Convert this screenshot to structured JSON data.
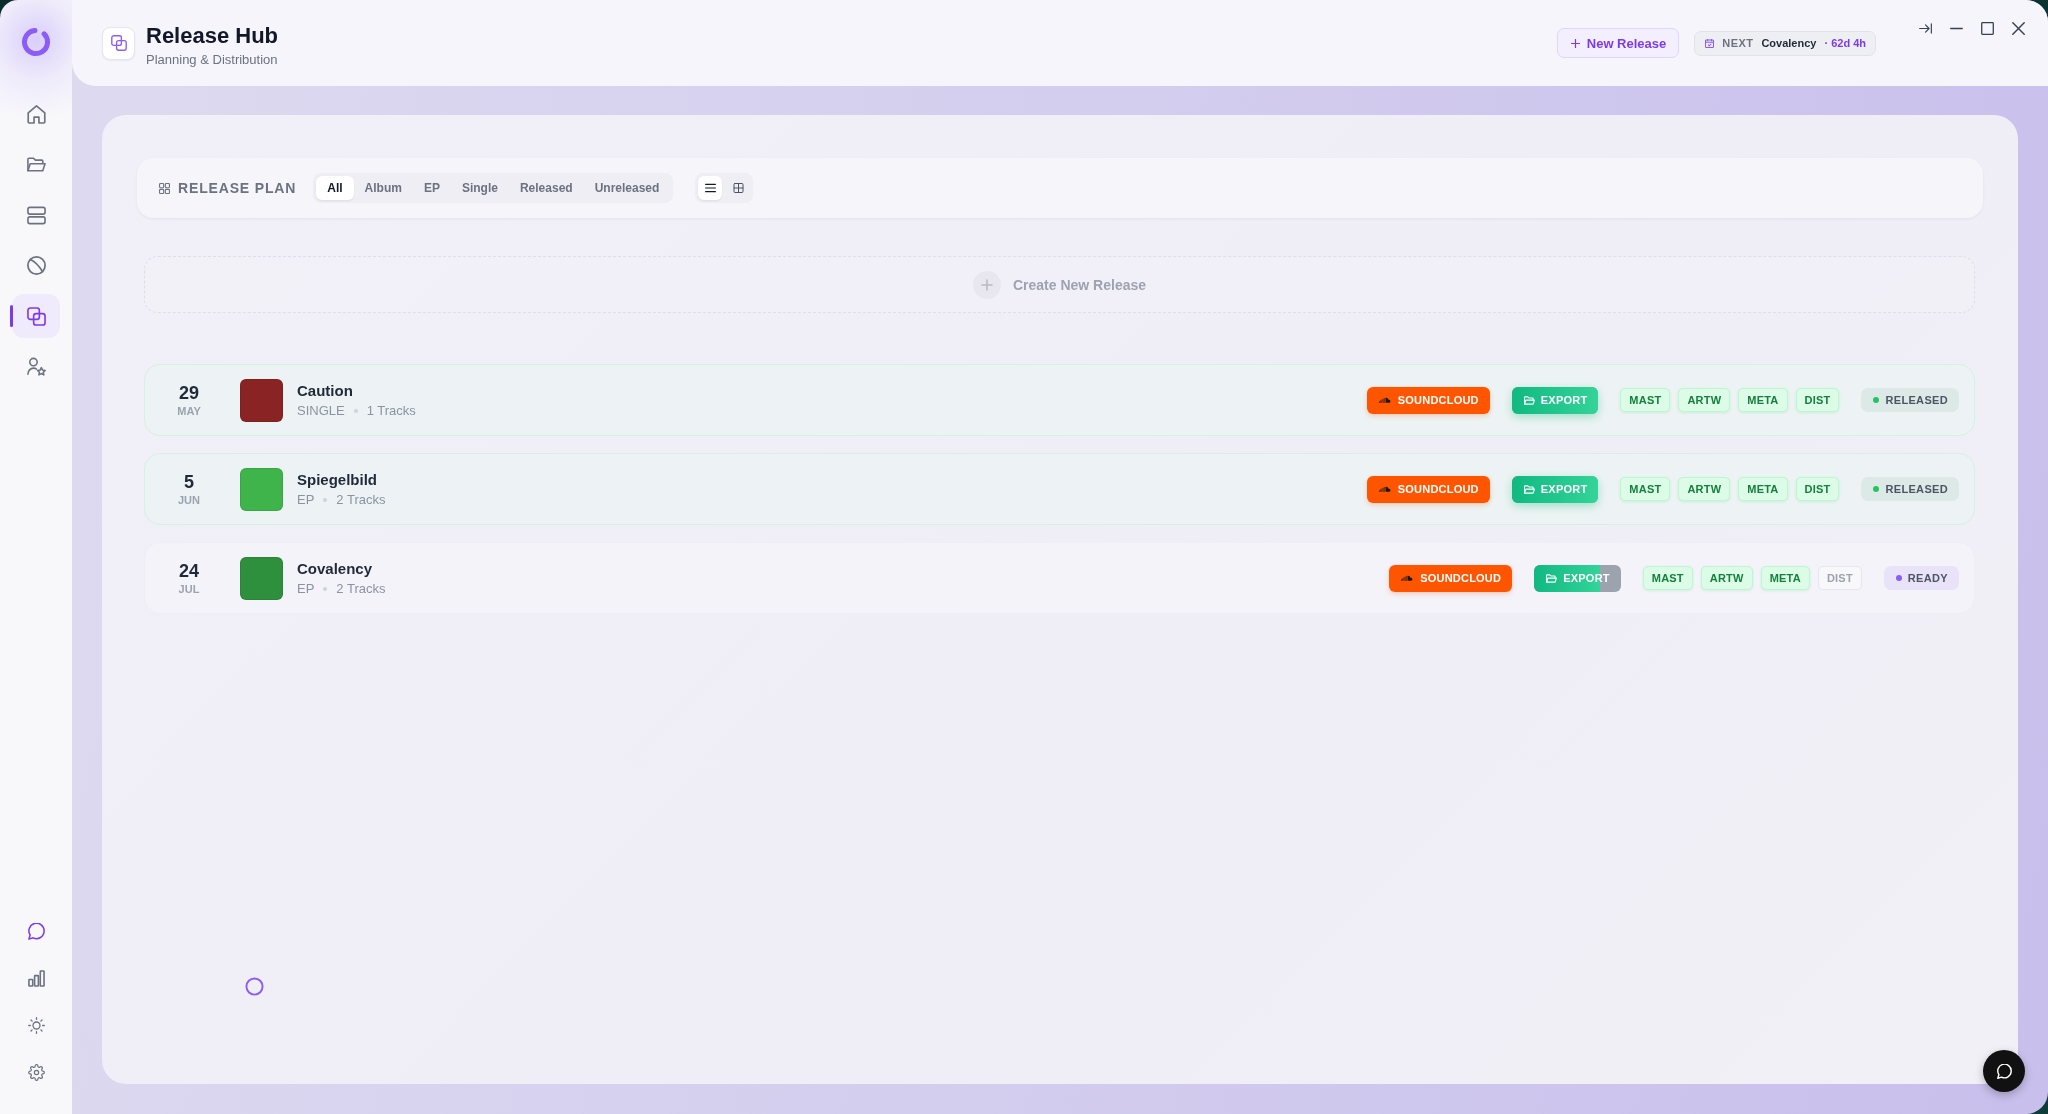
{
  "sidebar": {
    "nav_items": [
      {
        "selected": false
      },
      {
        "selected": false
      },
      {
        "selected": false
      },
      {
        "selected": false
      },
      {
        "selected": true
      },
      {
        "selected": false
      }
    ],
    "bottom_items": [
      {
        "active": true
      },
      {
        "active": false
      },
      {
        "active": false
      },
      {
        "active": false
      }
    ]
  },
  "header": {
    "title": "Release Hub",
    "subtitle": "Planning & Distribution",
    "new_release_button": "New Release",
    "next_chip": {
      "label": "NEXT",
      "release": "Covalency",
      "countdown": "· 62d 4h"
    }
  },
  "release_plan": {
    "title": "RELEASE PLAN",
    "filters": [
      {
        "label": "All",
        "selected": true
      },
      {
        "label": "Album",
        "selected": false
      },
      {
        "label": "EP",
        "selected": false
      },
      {
        "label": "Single",
        "selected": false
      },
      {
        "label": "Released",
        "selected": false
      },
      {
        "label": "Unreleased",
        "selected": false
      }
    ],
    "views": [
      {
        "selected": true
      },
      {
        "selected": false
      }
    ],
    "create_button": "Create New Release",
    "releases": [
      {
        "day": "29",
        "month": "MAY",
        "title": "Caution",
        "type": "SINGLE",
        "tracks": "1 Tracks",
        "cover": {
          "color": "#8a2424"
        },
        "platform_button": "SOUNDCLOUD",
        "export": {
          "label": "EXPORT",
          "level": 1
        },
        "checks": [
          {
            "label": "MAST",
            "done": true
          },
          {
            "label": "ARTW",
            "done": true
          },
          {
            "label": "META",
            "done": true
          },
          {
            "label": "DIST",
            "done": true
          }
        ],
        "status": {
          "label": "RELEASED",
          "kind": "released"
        }
      },
      {
        "day": "5",
        "month": "JUN",
        "title": "Spiegelbild",
        "type": "EP",
        "tracks": "2 Tracks",
        "cover": {
          "color": "#3fb44a"
        },
        "platform_button": "SOUNDCLOUD",
        "export": {
          "label": "EXPORT",
          "level": 1
        },
        "checks": [
          {
            "label": "MAST",
            "done": true
          },
          {
            "label": "ARTW",
            "done": true
          },
          {
            "label": "META",
            "done": true
          },
          {
            "label": "DIST",
            "done": true
          }
        ],
        "status": {
          "label": "RELEASED",
          "kind": "released"
        }
      },
      {
        "day": "24",
        "month": "JUL",
        "title": "Covalency",
        "type": "EP",
        "tracks": "2 Tracks",
        "cover": {
          "color": "#2e8f3c"
        },
        "platform_button": "SOUNDCLOUD",
        "export": {
          "label": "EXPORT",
          "level": 0.76
        },
        "checks": [
          {
            "label": "MAST",
            "done": true
          },
          {
            "label": "ARTW",
            "done": true
          },
          {
            "label": "META",
            "done": true
          },
          {
            "label": "DIST",
            "done": false
          }
        ],
        "status": {
          "label": "READY",
          "kind": "ready"
        }
      }
    ]
  }
}
